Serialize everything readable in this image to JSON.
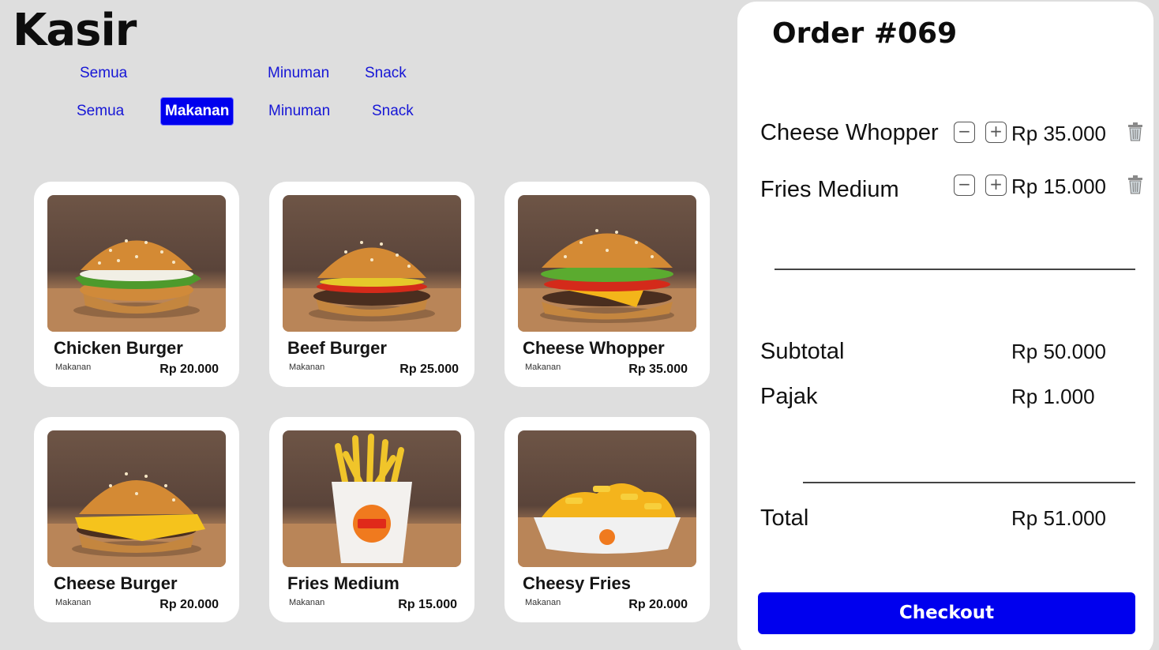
{
  "app": {
    "title": "Kasir"
  },
  "categories_top": [
    {
      "label": "Semua"
    },
    {
      "label": "Minuman"
    },
    {
      "label": "Snack"
    }
  ],
  "categories": [
    {
      "label": "Semua",
      "active": false
    },
    {
      "label": "Makanan",
      "active": true
    },
    {
      "label": "Minuman",
      "active": false
    },
    {
      "label": "Snack",
      "active": false
    }
  ],
  "products": [
    {
      "name": "Chicken Burger",
      "category": "Makanan",
      "price": "Rp 20.000",
      "image": "chicken-burger-image"
    },
    {
      "name": "Beef Burger",
      "category": "Makanan",
      "price": "Rp 25.000",
      "image": "beef-burger-image"
    },
    {
      "name": "Cheese Whopper",
      "category": "Makanan",
      "price": "Rp 35.000",
      "image": "cheese-whopper-image"
    },
    {
      "name": "Cheese Burger",
      "category": "Makanan",
      "price": "Rp 20.000",
      "image": "cheese-burger-image"
    },
    {
      "name": "Fries Medium",
      "category": "Makanan",
      "price": "Rp 15.000",
      "image": "fries-medium-image"
    },
    {
      "name": "Cheesy Fries",
      "category": "Makanan",
      "price": "Rp 20.000",
      "image": "cheesy-fries-image"
    }
  ],
  "order": {
    "title": "Order #069",
    "items": [
      {
        "name": "Cheese Whopper",
        "price": "Rp 35.000"
      },
      {
        "name": "Fries Medium",
        "price": "Rp 15.000"
      }
    ],
    "subtotal_label": "Subtotal",
    "subtotal_value": "Rp 50.000",
    "tax_label": "Pajak",
    "tax_value": "Rp 1.000",
    "total_label": "Total",
    "total_value": "Rp 51.000",
    "checkout_label": "Checkout",
    "icons": {
      "decrease": "minus-icon",
      "increase": "plus-icon",
      "remove": "trash-icon"
    }
  },
  "colors": {
    "accent": "#0000ee",
    "category_text": "#1616d6",
    "background": "#dedede",
    "panel": "#ffffff"
  }
}
